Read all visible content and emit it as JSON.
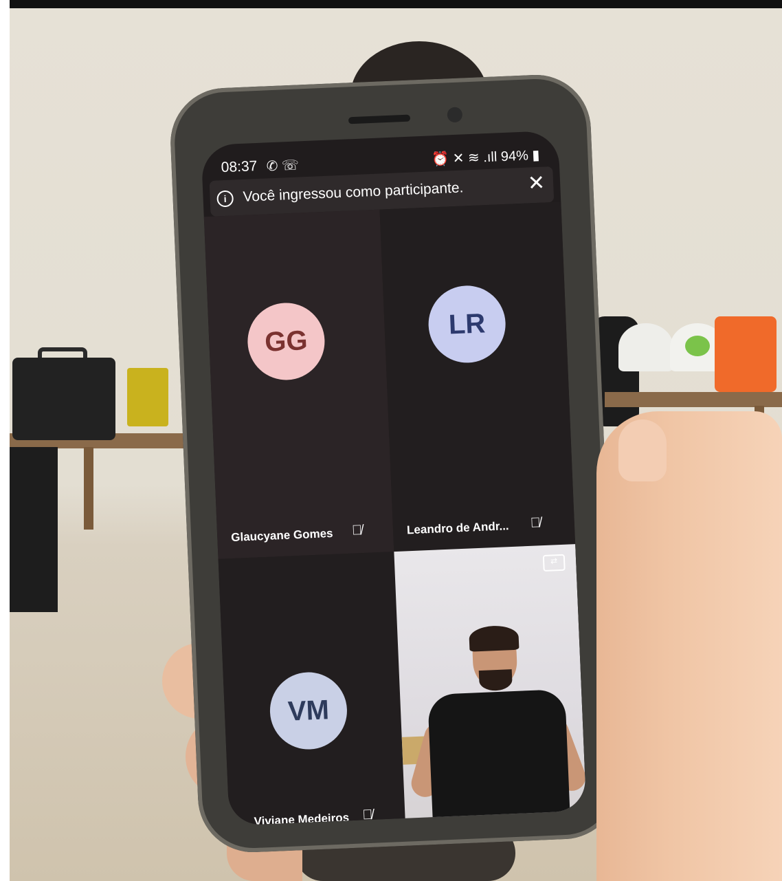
{
  "status_bar": {
    "time": "08:37",
    "left_icons": "✆ ☏",
    "right_icons": "⏰ ✕ ≋ .ıll",
    "battery": "94%"
  },
  "banner": {
    "text": "Você ingressou como participante.",
    "info_icon": "i",
    "close_icon": "✕"
  },
  "participants": [
    {
      "initials": "GG",
      "name": "Glaucyane Gomes",
      "avatar_color": "#f4c6c8",
      "text_color": "#7a3230"
    },
    {
      "initials": "LR",
      "name": "Leandro de Andr...",
      "avatar_color": "#c8cdf0",
      "text_color": "#2d3a6e"
    },
    {
      "initials": "VM",
      "name": "Viviane Medeiros",
      "avatar_color": "#c9d0e6",
      "text_color": "#2e3b5c"
    }
  ],
  "mute_icon": "🎙̸",
  "nav": {
    "recent": "|||",
    "home": "◯",
    "back": "<"
  }
}
